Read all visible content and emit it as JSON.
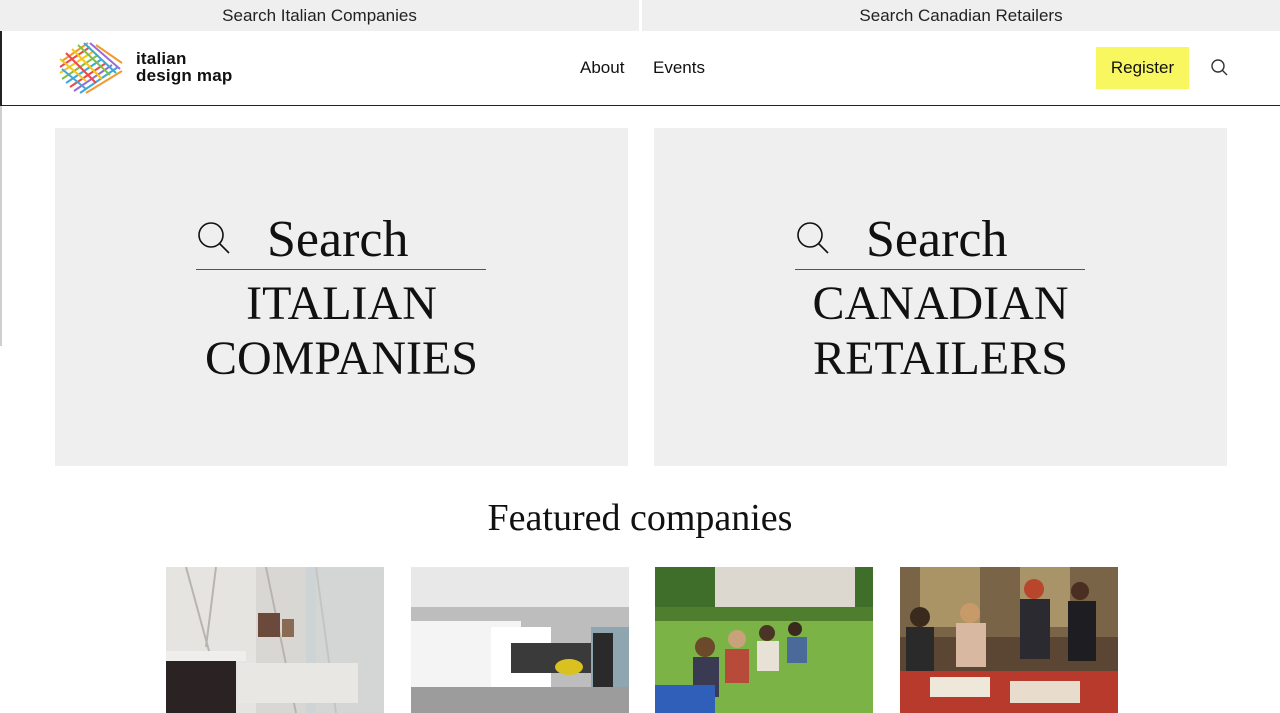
{
  "top_tabs": {
    "italian": "Search Italian Companies",
    "canadian": "Search Canadian Retailers"
  },
  "header": {
    "logo_line1": "italian",
    "logo_line2": "design map",
    "nav": {
      "about": "About",
      "events": "Events"
    },
    "register_label": "Register",
    "search_icon": "search-icon"
  },
  "panels": {
    "italian": {
      "search_word": "Search",
      "line1": "ITALIAN",
      "line2": "COMPANIES"
    },
    "canadian": {
      "search_word": "Search",
      "line1": "CANADIAN",
      "line2": "RETAILERS"
    }
  },
  "featured": {
    "heading": "Featured companies",
    "thumbnails": [
      "marble-bathroom",
      "white-showroom",
      "students-on-lawn",
      "design-workshop"
    ]
  },
  "colors": {
    "register_bg": "#f8f760",
    "panel_bg": "#efefef",
    "tab_bg": "#efefef"
  }
}
